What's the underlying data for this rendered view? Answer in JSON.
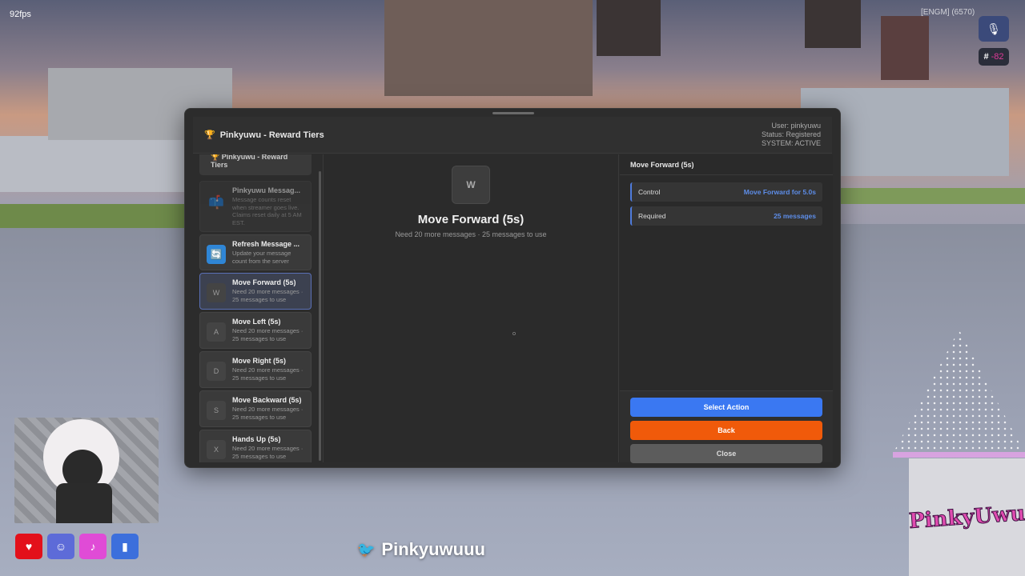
{
  "fps": "92fps",
  "hud": {
    "top_text": "[ENGM]  (6570)",
    "mic_icon": "mic-muted-icon",
    "id_hash": "#",
    "id_num": "-82"
  },
  "panel": {
    "title": "Pinkyuwu - Reward Tiers",
    "user_line": "User: pinkyuwu",
    "status_line": "Status: Registered",
    "system_line": "SYSTEM: ACTIVE"
  },
  "sidebar": {
    "header": "Pinkyuwu - Reward Tiers",
    "items": [
      {
        "key": "",
        "title": "Pinkyuwu Messag...",
        "desc": "Message counts reset when streamer goes live. Claims reset daily at 5 AM EST."
      },
      {
        "key": "",
        "title": "Refresh Message ...",
        "desc": "Update your message count from the server"
      },
      {
        "key": "W",
        "title": "Move Forward (5s)",
        "desc": "Need 20 more messages · 25 messages to use"
      },
      {
        "key": "A",
        "title": "Move Left (5s)",
        "desc": "Need 20 more messages · 25 messages to use"
      },
      {
        "key": "D",
        "title": "Move Right (5s)",
        "desc": "Need 20 more messages · 25 messages to use"
      },
      {
        "key": "S",
        "title": "Move Backward (5s)",
        "desc": "Need 20 more messages · 25 messages to use"
      },
      {
        "key": "X",
        "title": "Hands Up (5s)",
        "desc": "Need 20 more messages · 25 messages to use"
      }
    ]
  },
  "detail": {
    "key": "W",
    "title": "Move Forward (5s)",
    "subtitle": "Need 20 more messages · 25 messages to use"
  },
  "info": {
    "title": "Move Forward (5s)",
    "rows": [
      {
        "label": "Control",
        "value": "Move Forward for 5.0s"
      },
      {
        "label": "Required",
        "value": "25 messages"
      }
    ]
  },
  "buttons": {
    "select": "Select Action",
    "back": "Back",
    "close": "Close"
  },
  "overlay": {
    "twitter_handle": "Pinkyuwuuu",
    "logo": "PinkyUwu"
  },
  "colors": {
    "accent_blue": "#3a78f2",
    "back_orange": "#f05a0a",
    "value_blue": "#5d8de8",
    "panel_bg": "#2c2c2c"
  }
}
